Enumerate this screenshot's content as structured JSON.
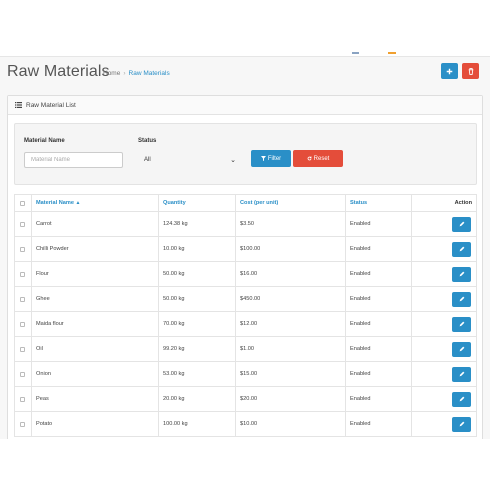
{
  "colors": {
    "accent": "#2a8fc7",
    "danger": "#e44d3a",
    "top_mark_1": "#8aa3c2",
    "top_mark_2": "#f09a5a",
    "top_mark_3": "#f0a030"
  },
  "header": {
    "title": "Raw Materials",
    "breadcrumb": {
      "home": "Home",
      "current": "Raw Materials"
    },
    "add_icon": "plus-icon",
    "delete_icon": "trash-icon"
  },
  "panel": {
    "title": "Raw Material List",
    "icon": "list-icon"
  },
  "filter": {
    "name_label": "Material Name",
    "name_placeholder": "Material Name",
    "status_label": "Status",
    "status_value": "All",
    "filter_button": "Filter",
    "reset_button": "Reset"
  },
  "table": {
    "headers": {
      "name": "Material Name",
      "quantity": "Quantity",
      "cost": "Cost (per unit)",
      "status": "Status",
      "action": "Action"
    },
    "rows": [
      {
        "name": "Carrot",
        "quantity": "124.38 kg",
        "cost": "$3.50",
        "status": "Enabled"
      },
      {
        "name": "Chilli Powder",
        "quantity": "10.00 kg",
        "cost": "$100.00",
        "status": "Enabled"
      },
      {
        "name": "Flour",
        "quantity": "50.00 kg",
        "cost": "$16.00",
        "status": "Enabled"
      },
      {
        "name": "Ghee",
        "quantity": "50.00 kg",
        "cost": "$450.00",
        "status": "Enabled"
      },
      {
        "name": "Maida flour",
        "quantity": "70.00 kg",
        "cost": "$12.00",
        "status": "Enabled"
      },
      {
        "name": "Oil",
        "quantity": "99.20 kg",
        "cost": "$1.00",
        "status": "Enabled"
      },
      {
        "name": "Onion",
        "quantity": "53.00 kg",
        "cost": "$15.00",
        "status": "Enabled"
      },
      {
        "name": "Peas",
        "quantity": "20.00 kg",
        "cost": "$20.00",
        "status": "Enabled"
      },
      {
        "name": "Potato",
        "quantity": "100.00 kg",
        "cost": "$10.00",
        "status": "Enabled"
      }
    ]
  }
}
